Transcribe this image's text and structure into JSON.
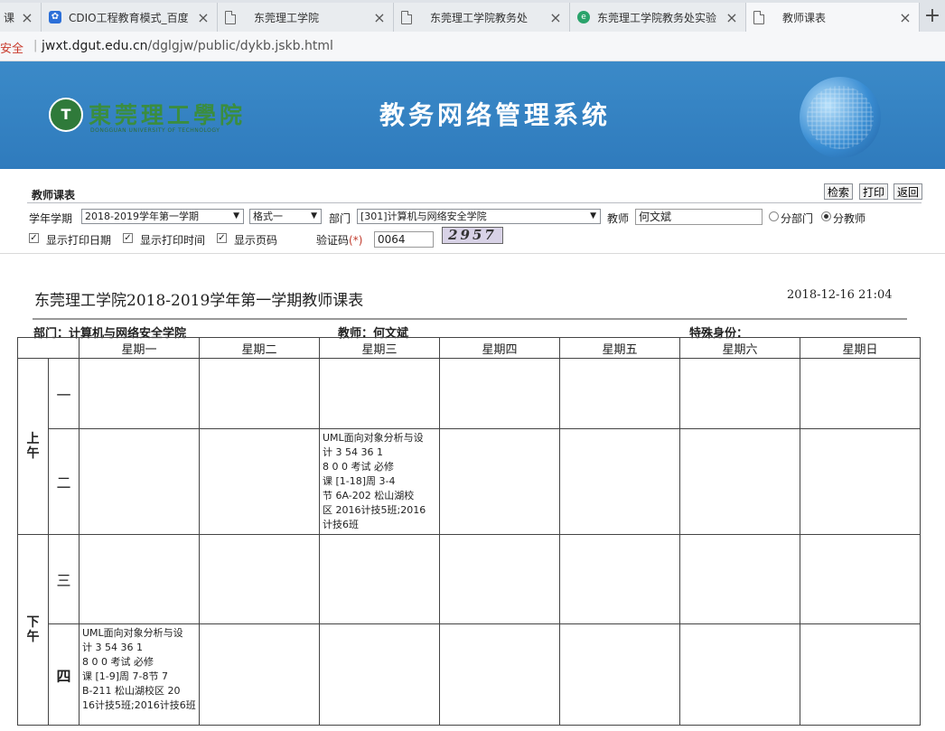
{
  "tabs": [
    {
      "title": "课",
      "icon": "none"
    },
    {
      "title": "CDIO工程教育模式_百度",
      "icon": "paw-icon"
    },
    {
      "title": "东莞理工学院",
      "icon": "doc-icon"
    },
    {
      "title": "东莞理工学院教务处",
      "icon": "doc-icon"
    },
    {
      "title": "东莞理工学院教务处实验",
      "icon": "green-icon"
    },
    {
      "title": "教师课表",
      "icon": "doc-icon"
    }
  ],
  "address": {
    "secure_label": "安全",
    "host": "jwxt.dgut.edu.cn",
    "path": "/dglgjw/public/dykb.jskb.html"
  },
  "banner": {
    "logo_text": "東莞理工學院",
    "logo_sub": "DONGGUAN UNIVERSITY OF TECHNOLOGY",
    "title": "教务网络管理系统"
  },
  "form": {
    "section_title": "教师课表",
    "buttons": {
      "search": "检索",
      "print": "打印",
      "back": "返回"
    },
    "term_label": "学年学期",
    "term_value": "2018-2019学年第一学期",
    "format_value": "格式一",
    "dept_label": "部门",
    "dept_value": "[301]计算机与网络安全学院",
    "teacher_label": "教师",
    "teacher_value": "何文斌",
    "radio_dept": "分部门",
    "radio_teacher": "分教师",
    "cb_date": "显示打印日期",
    "cb_time": "显示打印时间",
    "cb_page": "显示页码",
    "captcha_label": "验证码",
    "captcha_required": "(*)",
    "captcha_value": "0064",
    "captcha_image_text": "2957"
  },
  "report": {
    "title": "东莞理工学院2018-2019学年第一学期教师课表",
    "datetime": "2018-12-16 21:04",
    "dept": "部门：计算机与网络安全学院",
    "teacher": "教师：何文斌",
    "special": "特殊身份："
  },
  "timetable": {
    "days": [
      "星期一",
      "星期二",
      "星期三",
      "星期四",
      "星期五",
      "星期六",
      "星期日"
    ],
    "am_label": "上午",
    "pm_label": "下午",
    "periods": [
      "一",
      "二",
      "三",
      "四"
    ],
    "course_wed_p2": [
      "UML面向对象分析与设",
      "计 3 54 36 1",
      "8 0 0 考试 必修",
      "课 [1-18]周 3-4",
      "节 6A-202 松山湖校",
      "区 2016计技5班;2016",
      "计技6班"
    ],
    "course_mon_p4": [
      "UML面向对象分析与设",
      "计 3 54 36 1",
      "8 0 0 考试 必修",
      "课 [1-9]周 7-8节 7",
      "B-211 松山湖校区 20",
      "16计技5班;2016计技6班"
    ]
  }
}
